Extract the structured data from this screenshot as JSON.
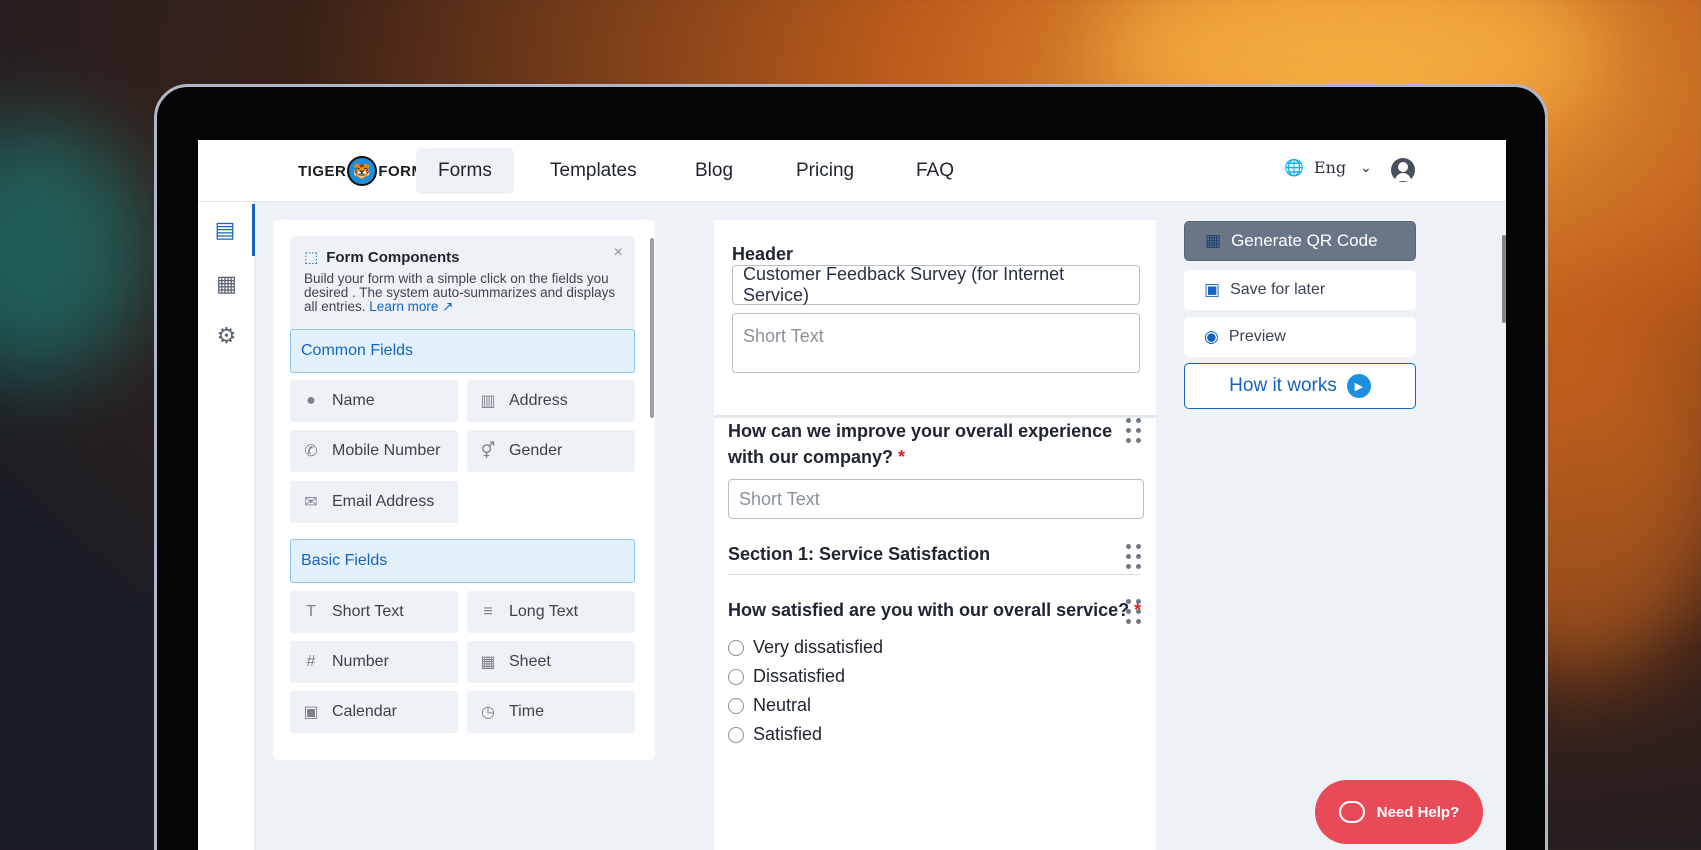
{
  "brand": {
    "logo_left": "TIGER",
    "logo_right": "FORM"
  },
  "nav": {
    "items": [
      {
        "label": "Forms",
        "active": true
      },
      {
        "label": "Templates"
      },
      {
        "label": "Blog"
      },
      {
        "label": "Pricing"
      },
      {
        "label": "FAQ"
      }
    ],
    "language": "Eng"
  },
  "components": {
    "title": "Form Components",
    "description": "Build your form with a simple click on the fields you desired . The system auto-summarizes and displays all entries.",
    "learn_more": "Learn more",
    "common_heading": "Common Fields",
    "common": [
      "Name",
      "Address",
      "Mobile Number",
      "Gender",
      "Email Address"
    ],
    "basic_heading": "Basic Fields",
    "basic": [
      "Short Text",
      "Long Text",
      "Number",
      "Sheet",
      "Calendar",
      "Time"
    ]
  },
  "form": {
    "header_label": "Header",
    "title_value": "Customer Feedback Survey (for Internet Service)",
    "short_text_placeholder": "Short Text",
    "q1": "How can we improve your overall experience with our company?",
    "q1_placeholder": "Short Text",
    "section1": "Section 1: Service Satisfaction",
    "q2": "How satisfied are you with our overall service?",
    "required_mark": "*",
    "options": [
      "Very dissatisfied",
      "Dissatisfied",
      "Neutral",
      "Satisfied"
    ]
  },
  "actions": {
    "qr": "Generate QR Code",
    "save": "Save for later",
    "preview": "Preview",
    "how": "How it works"
  },
  "help": {
    "label": "Need Help?"
  },
  "colors": {
    "accent": "#1565c0",
    "help": "#e84b58"
  }
}
